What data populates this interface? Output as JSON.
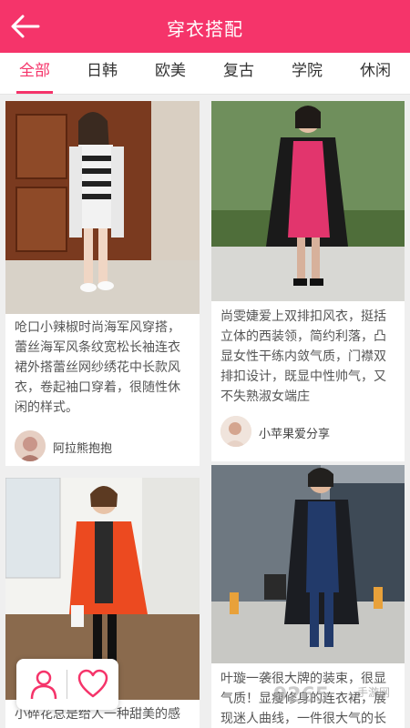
{
  "header": {
    "title": "穿衣搭配",
    "back_icon": "arrow-left-icon"
  },
  "tabs": [
    {
      "label": "全部",
      "active": true
    },
    {
      "label": "日韩",
      "active": false
    },
    {
      "label": "欧美",
      "active": false
    },
    {
      "label": "复古",
      "active": false
    },
    {
      "label": "学院",
      "active": false
    },
    {
      "label": "休闲",
      "active": false
    }
  ],
  "cards": [
    {
      "description": "呛口小辣椒时尚海军风穿搭，蕾丝海军风条纹宽松长袖连衣裙外搭蕾丝网纱绣花中长款风衣，卷起袖口穿着，很随性休闲的样式。",
      "author": "阿拉熊抱抱"
    },
    {
      "description": "尚雯婕爱上双排扣风衣，挺括立体的西装领，简约利落，凸显女性干练内敛气质，门襟双排扣设计，既显中性帅气，又不失熟淑女端庄",
      "author": "小苹果爱分享"
    },
    {
      "description": "小碎花总是给人一种甜美的感",
      "author": ""
    },
    {
      "description": "叶璇一袭很大牌的装束，很显气质！显瘦修身的连衣裙，展现迷人曲线，一件很大气的长",
      "author": ""
    }
  ],
  "float_bar": {
    "left_icon": "user-icon",
    "right_icon": "heart-icon"
  },
  "watermark": {
    "text": "9265",
    "sub": "手游网"
  },
  "colors": {
    "accent": "#f5346a",
    "background": "#efefef"
  }
}
